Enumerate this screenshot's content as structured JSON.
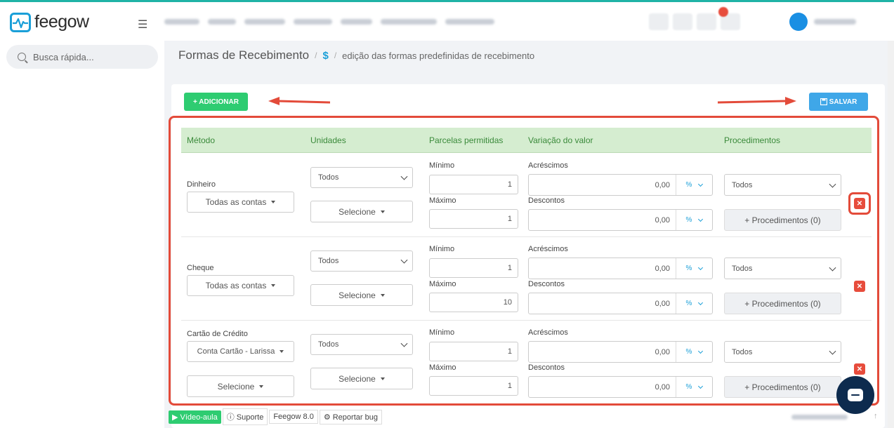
{
  "app": {
    "name": "feegow"
  },
  "sidebar": {
    "search_placeholder": "Busca rápida..."
  },
  "breadcrumb": {
    "title": "Formas de Recebimento",
    "icon": "$",
    "subtitle": "edição das formas predefinidas de recebimento"
  },
  "toolbar": {
    "add_label": "+ ADICIONAR",
    "save_label": "SALVAR"
  },
  "table": {
    "headers": {
      "metodo": "Método",
      "unidades": "Unidades",
      "parcelas": "Parcelas permitidas",
      "variacao": "Variação do valor",
      "procedimentos": "Procedimentos"
    },
    "labels": {
      "minimo": "Mínimo",
      "maximo": "Máximo",
      "acrescimos": "Acréscimos",
      "descontos": "Descontos",
      "percent": "%"
    },
    "rows": [
      {
        "method": "Dinheiro",
        "account": "Todas as contas",
        "units": "Todos",
        "units_select": "Selecione",
        "min": "1",
        "max": "1",
        "acrescimo": "0,00",
        "desconto": "0,00",
        "procedimentos": "Todos",
        "proc_button": "+ Procedimentos (0)"
      },
      {
        "method": "Cheque",
        "account": "Todas as contas",
        "units": "Todos",
        "units_select": "Selecione",
        "min": "1",
        "max": "10",
        "acrescimo": "0,00",
        "desconto": "0,00",
        "procedimentos": "Todos",
        "proc_button": "+ Procedimentos (0)"
      },
      {
        "method": "Cartão de Crédito",
        "account": "Conta Cartão - Larissa",
        "account2": "Selecione",
        "units": "Todos",
        "units_select": "Selecione",
        "min": "1",
        "max": "1",
        "acrescimo": "0,00",
        "desconto": "0,00",
        "procedimentos": "Todos",
        "proc_button": "+ Procedimentos (0)"
      }
    ]
  },
  "footer": {
    "video": "Vídeo-aula",
    "suporte": "Suporte",
    "version": "Feegow 8.0",
    "bug": "Reportar bug"
  },
  "colors": {
    "accent": "#1a9fd8",
    "success": "#2ecc71",
    "danger": "#e74c3c",
    "highlight": "#e34b3a",
    "header_bg": "#d5edd0"
  }
}
